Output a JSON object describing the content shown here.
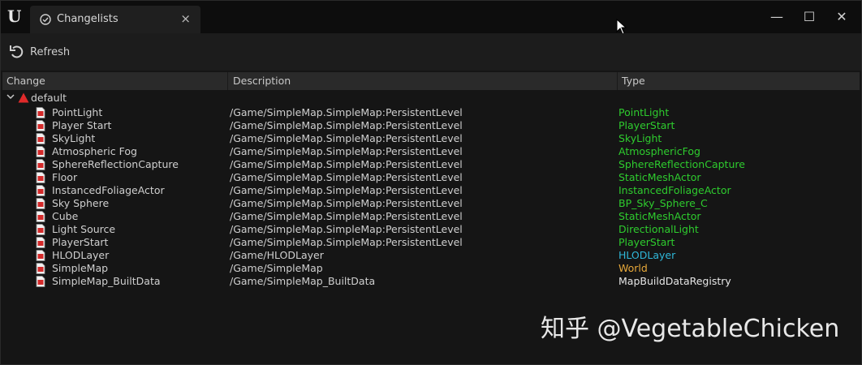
{
  "window": {
    "tab_title": "Changelists",
    "tab_close": "×",
    "minimize": "—",
    "maximize": "☐",
    "close": "✕",
    "logo": "U"
  },
  "toolbar": {
    "refresh_label": "Refresh"
  },
  "columns": {
    "change": "Change",
    "description": "Description",
    "type": "Type"
  },
  "group": {
    "label": "default",
    "icon": "warning-icon"
  },
  "rows": [
    {
      "name": "PointLight",
      "desc": "/Game/SimpleMap.SimpleMap:PersistentLevel",
      "type": "PointLight"
    },
    {
      "name": "Player Start",
      "desc": "/Game/SimpleMap.SimpleMap:PersistentLevel",
      "type": "PlayerStart"
    },
    {
      "name": "SkyLight",
      "desc": "/Game/SimpleMap.SimpleMap:PersistentLevel",
      "type": "SkyLight"
    },
    {
      "name": "Atmospheric Fog",
      "desc": "/Game/SimpleMap.SimpleMap:PersistentLevel",
      "type": "AtmosphericFog"
    },
    {
      "name": "SphereReflectionCapture",
      "desc": "/Game/SimpleMap.SimpleMap:PersistentLevel",
      "type": "SphereReflectionCapture"
    },
    {
      "name": "Floor",
      "desc": "/Game/SimpleMap.SimpleMap:PersistentLevel",
      "type": "StaticMeshActor"
    },
    {
      "name": "InstancedFoliageActor",
      "desc": "/Game/SimpleMap.SimpleMap:PersistentLevel",
      "type": "InstancedFoliageActor"
    },
    {
      "name": "Sky Sphere",
      "desc": "/Game/SimpleMap.SimpleMap:PersistentLevel",
      "type": "BP_Sky_Sphere_C"
    },
    {
      "name": "Cube",
      "desc": "/Game/SimpleMap.SimpleMap:PersistentLevel",
      "type": "StaticMeshActor"
    },
    {
      "name": "Light Source",
      "desc": "/Game/SimpleMap.SimpleMap:PersistentLevel",
      "type": "DirectionalLight"
    },
    {
      "name": "PlayerStart",
      "desc": "/Game/SimpleMap.SimpleMap:PersistentLevel",
      "type": "PlayerStart"
    },
    {
      "name": "HLODLayer",
      "desc": "/Game/HLODLayer",
      "type": "HLODLayer"
    },
    {
      "name": "SimpleMap",
      "desc": "/Game/SimpleMap",
      "type": "World"
    },
    {
      "name": "SimpleMap_BuiltData",
      "desc": "/Game/SimpleMap_BuiltData",
      "type": "MapBuildDataRegistry"
    }
  ],
  "type_colors": {
    "default": "#2ecc2e",
    "HLODLayer": "#2fb7d8",
    "World": "#e8a93a",
    "MapBuildDataRegistry": "#e6e6e6"
  },
  "watermark": "知乎 @VegetableChicken"
}
